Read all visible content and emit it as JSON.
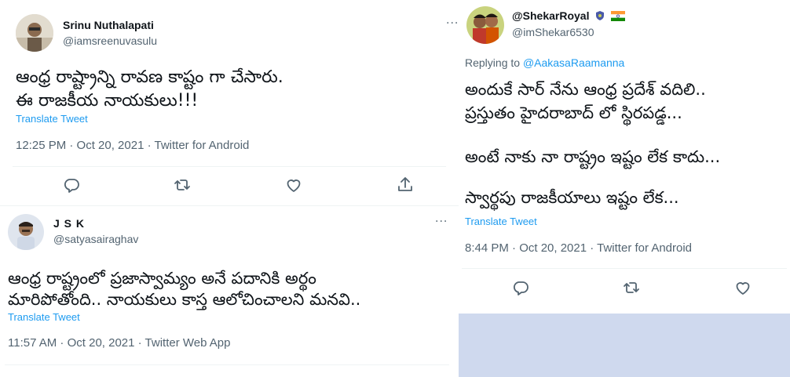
{
  "tweets": [
    {
      "name": "Srinu Nuthalapati",
      "handle": "@iamsreenuvasulu",
      "lines": [
        "ఆంధ్ర రాష్ట్రాన్ని రావణ కాష్టం గా చేసారు.",
        "ఈ రాజకీయ నాయకులు!!!"
      ],
      "translate": "Translate Tweet",
      "meta": "12:25 PM · Oct 20, 2021 · Twitter for Android",
      "actions": [
        "reply-icon",
        "retweet-icon",
        "like-icon",
        "share-icon"
      ]
    },
    {
      "name": "J S K",
      "handle": "@satyasairaghav",
      "lines": [
        "ఆంధ్ర రాష్ట్రంలో ప్రజాస్వామ్యం అనే పదానికి అర్థం",
        "మారిపోతోంది.. నాయకులు కాస్త ఆలోచించాలని మనవి.."
      ],
      "translate": "Translate Tweet",
      "meta": "11:57 AM · Oct 20, 2021 · Twitter Web App",
      "actions": []
    },
    {
      "name": "@ShekarRoyal",
      "handle": "@imShekar6530",
      "replying_label": "Replying to ",
      "replying_to": "@AakasaRaamanna",
      "lines": [
        "అందుకే సార్ నేను ఆంధ్ర ప్రదేశ్ వదిలి..",
        "ప్రస్తుతం హైదరాబాద్ లో స్థిరపడ్డ...",
        "అంటే నాకు నా రాష్ట్రం ఇష్టం లేక కాదు...",
        "స్వార్థపు రాజకీయాలు ఇష్టం లేక..."
      ],
      "translate": "Translate Tweet",
      "meta": "8:44 PM · Oct 20, 2021 · Twitter for Android",
      "actions": [
        "reply-icon",
        "retweet-icon",
        "like-icon"
      ]
    }
  ],
  "colors": {
    "text": "#0f1419",
    "muted": "#536471",
    "link": "#1d9bf0",
    "filler": "#cfd9ee",
    "divider": "#eff3f4"
  }
}
